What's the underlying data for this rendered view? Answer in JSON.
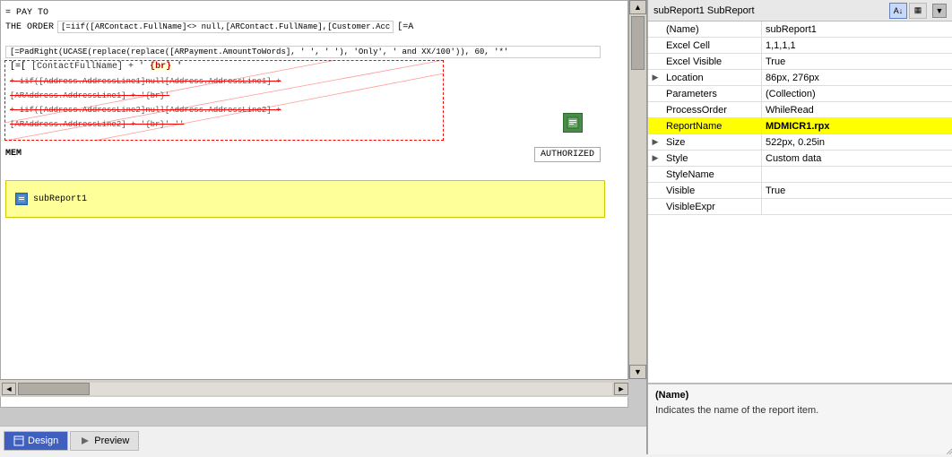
{
  "header": {
    "title": "subReport1 SubReport"
  },
  "properties_toolbar": {
    "sort_btn": "A↓",
    "grid_btn": "▦",
    "close_btn": "▼"
  },
  "properties": {
    "rows": [
      {
        "expand": false,
        "name": "(Name)",
        "value": "subReport1",
        "highlighted": false
      },
      {
        "expand": false,
        "name": "Excel Cell",
        "value": "1,1,1,1",
        "highlighted": false
      },
      {
        "expand": false,
        "name": "Excel Visible",
        "value": "True",
        "highlighted": false
      },
      {
        "expand": true,
        "name": "Location",
        "value": "86px, 276px",
        "highlighted": false
      },
      {
        "expand": false,
        "name": "Parameters",
        "value": "(Collection)",
        "highlighted": false
      },
      {
        "expand": false,
        "name": "ProcessOrder",
        "value": "WhileRead",
        "highlighted": false
      },
      {
        "expand": false,
        "name": "ReportName",
        "value": "MDMICR1.rpx",
        "highlighted": true
      },
      {
        "expand": true,
        "name": "Size",
        "value": "522px, 0.25in",
        "highlighted": false
      },
      {
        "expand": true,
        "name": "Style",
        "value": "Custom data",
        "highlighted": false
      },
      {
        "expand": false,
        "name": "StyleName",
        "value": "",
        "highlighted": false
      },
      {
        "expand": false,
        "name": "Visible",
        "value": "True",
        "highlighted": false
      },
      {
        "expand": false,
        "name": "VisibleExpr",
        "value": "",
        "highlighted": false
      }
    ]
  },
  "description": {
    "title": "(Name)",
    "text": "Indicates the name of the report item."
  },
  "canvas": {
    "pay_to": "= PAY TO",
    "the_order": "THE ORDER",
    "formula_iif": "[=iif([ARContact.FullName]<>  null,[ARContact.FullName],[Customer.Acc",
    "formula_padright": "[=PadRight(UCASE(replace(replace([ARPayment.AmountToWords], ' ', ' '), 'Only', ' and XX/100')), 60, '*'",
    "bracket_expr": "[=[",
    "address_lines": [
      "=[ContactFullName] + '{br}'",
      "+ iif([Address.AddressLine1]null[Address.AddressLine1] +",
      "[ARAddress.AddressLine1] + '{br}'",
      "+ iif([Address.AddressLine2]null[Address.AddressLine2] +",
      "[ARAddress.AddressLine2] + '{br}'  ''"
    ],
    "mem_label": "MEM",
    "authorized_label": "AUTHORIZED",
    "subreport_label": "subReport1"
  },
  "tabs": [
    {
      "id": "design",
      "label": "Design",
      "active": true
    },
    {
      "id": "preview",
      "label": "Preview",
      "active": false
    }
  ]
}
